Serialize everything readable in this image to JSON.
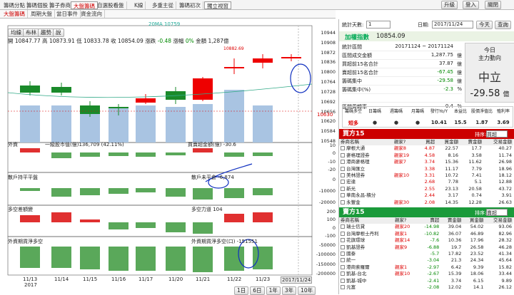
{
  "tabs": [
    "籌碼分點",
    "籌碼個股",
    "籌子券商",
    "大盤籌碼",
    "自選股看盤",
    "K線",
    "多重主從",
    "籌碼初次",
    "獨立視窗"
  ],
  "subtabs": [
    "大盤籌碼",
    "周期大盤",
    "當日事件",
    "資金流向"
  ],
  "toolbar": {
    "upgrade": "升級",
    "login": "登入",
    "close": "關閉"
  },
  "chart": {
    "ma_label": "20MA 10759",
    "btns": [
      "均線",
      "布林",
      "趨勢",
      "說"
    ],
    "ohlc": "開 10847.77 高 10873.91 低 10833.78 收 10854.09",
    "chg_label": "漲跌",
    "chg": "-0.48",
    "pct_label": "漲幅",
    "pct": "0%",
    "vol": "金額 1,287億",
    "cur_price": "10630",
    "peak": "10882.69",
    "y1": [
      "10944",
      "10908",
      "10872",
      "10836",
      "10800",
      "10764",
      "10728",
      "10692",
      "10656",
      "10620",
      "10584",
      "10548"
    ],
    "p1": {
      "label": "外資",
      "mid": "一級股市值(億)136,709 (42.11%)",
      "sub": "買賣超金額(億) -30.6",
      "y": [
        "10",
        "0",
        "-10",
        "-20"
      ]
    },
    "p2": {
      "label": "散戶持平平盤",
      "sub": "散戶未平倉 -6,874",
      "y": [
        "0",
        "-10000",
        "-20000"
      ]
    },
    "p3": {
      "label": "多空差額變",
      "sub": "多空力道 104",
      "y": [
        "200",
        "100",
        "0",
        "-100"
      ]
    },
    "p4": {
      "label": "外資期貨淨多空",
      "sub": "外資期貨淨多空(口) -151551",
      "y": [
        "-50000",
        "-100000",
        "-150000",
        "-200000"
      ]
    },
    "x": [
      "11/13",
      "11/14",
      "11/15",
      "11/16",
      "11/17",
      "11/20",
      "11/21",
      "11/22",
      "11/23"
    ],
    "x_year": "2017",
    "x_cur": "2017/11/24",
    "nav": [
      "1日",
      "6日",
      "1年",
      "3年",
      "10年"
    ]
  },
  "form": {
    "count_label": "統計天數:",
    "count": "1",
    "date_label": "日期:",
    "date": "2017/11/24",
    "today": "今天",
    "query": "查詢"
  },
  "index": {
    "name": "加權指數",
    "value": "10854.09"
  },
  "stats": [
    [
      "統計區間",
      "20171124 ~ 20171124"
    ],
    [
      "區間成交金額",
      "1,287.75",
      "億"
    ],
    [
      "買超前15名合計",
      "37.87",
      "億"
    ],
    [
      "賣超前15名合計",
      "-67.45",
      "億"
    ],
    [
      "籌碼集中",
      "-29.58",
      "億"
    ],
    [
      "籌碼集中(%)",
      "-2.3",
      "%"
    ],
    [
      "",
      "",
      ""
    ],
    [
      "區間周轉率",
      "0.4",
      "%"
    ]
  ],
  "today": {
    "l1": "今日",
    "l2": "主力動向",
    "state": "中立",
    "val": "-29.58",
    "unit": "億"
  },
  "mini": {
    "heads": [
      "籌碼多空",
      "日籌碼",
      "週籌碼",
      "月籌碼",
      "發行Yo/Y",
      "本益比",
      "股價淨值比",
      "殖利率"
    ],
    "row": [
      "短多",
      "",
      "",
      "",
      "10.41",
      "15.5",
      "1.87",
      "3.69"
    ]
  },
  "buy": {
    "title": "買方15",
    "sort_label": "排序:",
    "sort": "買超",
    "cols": [
      "券商名稱",
      "親家?",
      "買超",
      "買金額",
      "賣金額",
      "交易金額"
    ],
    "rows": [
      [
        "摩根大通",
        "親家8",
        "4.87",
        "22.57",
        "17.7",
        "40.27"
      ],
      [
        "麥格理證券",
        "親家19",
        "4.58",
        "8.16",
        "3.58",
        "11.74"
      ],
      [
        "港商麥格理",
        "親家7",
        "3.74",
        "15.36",
        "11.62",
        "26.98"
      ],
      [
        "台灣匯立",
        "",
        "3.38",
        "11.17",
        "7.79",
        "18.96"
      ],
      [
        "美林證券",
        "親家10",
        "3.31",
        "10.72",
        "7.41",
        "18.12"
      ],
      [
        "宏達",
        "",
        "2.68",
        "7.78",
        "5.1",
        "12.88"
      ],
      [
        "新光",
        "",
        "2.55",
        "23.13",
        "20.58",
        "43.72"
      ],
      [
        "華南永昌-積分",
        "",
        "2.44",
        "3.17",
        "0.74",
        "3.91"
      ],
      [
        "永豐金",
        "親家30",
        "2.08",
        "14.35",
        "12.28",
        "26.63"
      ]
    ]
  },
  "sell": {
    "title": "賣方15",
    "sort_label": "排序:",
    "sort": "賣超",
    "cols": [
      "券商名稱",
      "親家?",
      "賣超",
      "賣金額",
      "買金額",
      "交易金額"
    ],
    "rows": [
      [
        "瑞士信貸",
        "親家20",
        "-14.98",
        "39.04",
        "54.02",
        "93.06"
      ],
      [
        "台灣摩根士丹利",
        "親家1",
        "-10.82",
        "36.07",
        "46.89",
        "82.96"
      ],
      [
        "花旗環球",
        "親家14",
        "-7.6",
        "10.36",
        "17.96",
        "28.32"
      ],
      [
        "凱基證券",
        "親家9",
        "-6.88",
        "19.7",
        "26.58",
        "46.28"
      ],
      [
        "國泰",
        "",
        "-5.7",
        "17.82",
        "23.52",
        "41.34"
      ],
      [
        "統一",
        "",
        "-3.04",
        "21.3",
        "24.34",
        "45.64"
      ],
      [
        "港商索羅爾",
        "親家1",
        "-2.97",
        "6.42",
        "9.39",
        "15.82"
      ],
      [
        "凱基-台北",
        "親家10",
        "-2.67",
        "15.39",
        "18.06",
        "33.44"
      ],
      [
        "凱基-城中",
        "",
        "-2.41",
        "3.74",
        "6.15",
        "9.89"
      ],
      [
        "元富",
        "",
        "-2.08",
        "12.02",
        "14.1",
        "26.12"
      ]
    ]
  }
}
